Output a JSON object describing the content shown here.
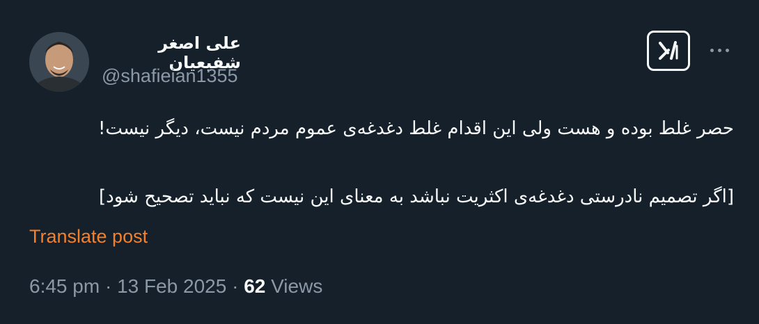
{
  "author": {
    "display_name": "علی اصغر شفیعیان",
    "handle": "@shafieian1355",
    "avatar_icon": "profile-photo"
  },
  "header_actions": {
    "grok_icon": "grok-icon",
    "more_icon": "more-icon"
  },
  "post": {
    "line1": "حصر غلط بوده و هست ولی این اقدام غلط دغدغه‌ی عموم مردم نیست، دیگر نیست!",
    "line2": "[اگر تصمیم نادرستی دغدغه‌ی اکثریت نباشد به معنای این نیست که نباید تصحیح شود]"
  },
  "translate_label": "Translate post",
  "meta": {
    "time": "6:45 pm",
    "separator": "·",
    "date": "13 Feb 2025",
    "views_count": "62",
    "views_label": "Views"
  },
  "colors": {
    "background": "#15202b",
    "text": "#f7f9f9",
    "secondary": "#8b98a5",
    "translate": "#f4802a"
  }
}
